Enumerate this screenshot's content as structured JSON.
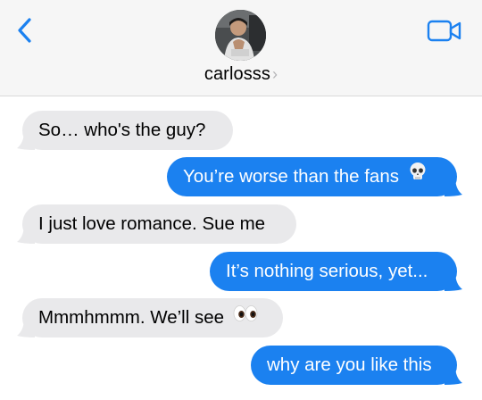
{
  "header": {
    "contact_name": "carlosss",
    "chevron": "›",
    "back_icon": "chevron-left-icon",
    "video_icon": "video-camera-icon"
  },
  "colors": {
    "header_bg": "#f6f6f6",
    "incoming_bubble": "#e9e9eb",
    "outgoing_bubble": "#1b81f0",
    "accent": "#1b81f0"
  },
  "messages": [
    {
      "direction": "incoming",
      "text": "So… who's the guy?"
    },
    {
      "direction": "outgoing",
      "text": "You’re worse than the fans",
      "emoji": "skull-emoji"
    },
    {
      "direction": "incoming",
      "text": "I just love romance. Sue me"
    },
    {
      "direction": "outgoing",
      "text": "It’s nothing serious, yet..."
    },
    {
      "direction": "incoming",
      "text": "Mmmhmmm. We’ll see",
      "emoji": "eyes-emoji"
    },
    {
      "direction": "outgoing",
      "text": "why are you like this"
    }
  ]
}
